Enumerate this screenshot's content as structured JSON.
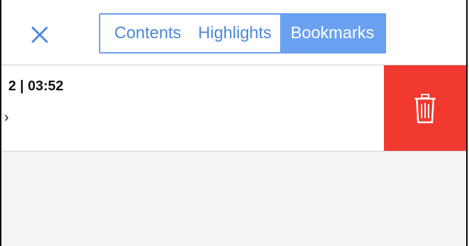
{
  "header": {
    "tabs": [
      {
        "label": "Contents",
        "selected": false
      },
      {
        "label": "Highlights",
        "selected": false
      },
      {
        "label": "Bookmarks",
        "selected": true
      }
    ]
  },
  "bookmarks": [
    {
      "title": "2 | 03:52",
      "subtitle": "›"
    }
  ],
  "icons": {
    "close": "close-icon",
    "delete": "trash-icon"
  },
  "colors": {
    "accent": "#6aa0f0",
    "accent_text": "#4a88dd",
    "delete": "#f2392f",
    "list_background": "#f4f4f4"
  }
}
